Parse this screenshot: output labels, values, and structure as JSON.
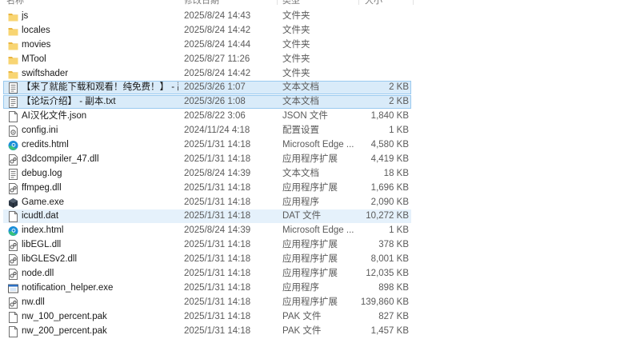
{
  "columns": {
    "name": "名称",
    "date": "修改日期",
    "type": "类型",
    "size": "大小"
  },
  "files": [
    {
      "name": "js",
      "date": "2025/8/24 14:43",
      "type": "文件夹",
      "size": "",
      "icon": "folder",
      "state": ""
    },
    {
      "name": "locales",
      "date": "2025/8/24 14:42",
      "type": "文件夹",
      "size": "",
      "icon": "folder",
      "state": ""
    },
    {
      "name": "movies",
      "date": "2025/8/24 14:44",
      "type": "文件夹",
      "size": "",
      "icon": "folder",
      "state": ""
    },
    {
      "name": "MTool",
      "date": "2025/8/27 11:26",
      "type": "文件夹",
      "size": "",
      "icon": "folder",
      "state": ""
    },
    {
      "name": "swiftshader",
      "date": "2025/8/24 14:42",
      "type": "文件夹",
      "size": "",
      "icon": "folder",
      "state": ""
    },
    {
      "name": "【来了就能下载和观看！纯免费！】 - 副...",
      "date": "2025/3/26 1:07",
      "type": "文本文档",
      "size": "2 KB",
      "icon": "text",
      "state": "sel"
    },
    {
      "name": "【论坛介绍】 - 副本.txt",
      "date": "2025/3/26 1:08",
      "type": "文本文档",
      "size": "2 KB",
      "icon": "text",
      "state": "sel"
    },
    {
      "name": "AI汉化文件.json",
      "date": "2025/8/22 3:06",
      "type": "JSON 文件",
      "size": "1,840 KB",
      "icon": "doc",
      "state": ""
    },
    {
      "name": "config.ini",
      "date": "2024/11/24 4:18",
      "type": "配置设置",
      "size": "1 KB",
      "icon": "config",
      "state": ""
    },
    {
      "name": "credits.html",
      "date": "2025/1/31 14:18",
      "type": "Microsoft Edge ...",
      "size": "4,580 KB",
      "icon": "edge",
      "state": ""
    },
    {
      "name": "d3dcompiler_47.dll",
      "date": "2025/1/31 14:18",
      "type": "应用程序扩展",
      "size": "4,419 KB",
      "icon": "dll",
      "state": ""
    },
    {
      "name": "debug.log",
      "date": "2025/8/24 14:39",
      "type": "文本文档",
      "size": "18 KB",
      "icon": "text",
      "state": ""
    },
    {
      "name": "ffmpeg.dll",
      "date": "2025/1/31 14:18",
      "type": "应用程序扩展",
      "size": "1,696 KB",
      "icon": "dll",
      "state": ""
    },
    {
      "name": "Game.exe",
      "date": "2025/1/31 14:18",
      "type": "应用程序",
      "size": "2,090 KB",
      "icon": "game",
      "state": ""
    },
    {
      "name": "icudtl.dat",
      "date": "2025/1/31 14:18",
      "type": "DAT 文件",
      "size": "10,272 KB",
      "icon": "doc",
      "state": "hover"
    },
    {
      "name": "index.html",
      "date": "2025/8/24 14:39",
      "type": "Microsoft Edge ...",
      "size": "1 KB",
      "icon": "edge",
      "state": ""
    },
    {
      "name": "libEGL.dll",
      "date": "2025/1/31 14:18",
      "type": "应用程序扩展",
      "size": "378 KB",
      "icon": "dll",
      "state": ""
    },
    {
      "name": "libGLESv2.dll",
      "date": "2025/1/31 14:18",
      "type": "应用程序扩展",
      "size": "8,001 KB",
      "icon": "dll",
      "state": ""
    },
    {
      "name": "node.dll",
      "date": "2025/1/31 14:18",
      "type": "应用程序扩展",
      "size": "12,035 KB",
      "icon": "dll",
      "state": ""
    },
    {
      "name": "notification_helper.exe",
      "date": "2025/1/31 14:18",
      "type": "应用程序",
      "size": "898 KB",
      "icon": "exe",
      "state": ""
    },
    {
      "name": "nw.dll",
      "date": "2025/1/31 14:18",
      "type": "应用程序扩展",
      "size": "139,860 KB",
      "icon": "dll",
      "state": ""
    },
    {
      "name": "nw_100_percent.pak",
      "date": "2025/1/31 14:18",
      "type": "PAK 文件",
      "size": "827 KB",
      "icon": "doc",
      "state": ""
    },
    {
      "name": "nw_200_percent.pak",
      "date": "2025/1/31 14:18",
      "type": "PAK 文件",
      "size": "1,457 KB",
      "icon": "doc",
      "state": ""
    }
  ]
}
